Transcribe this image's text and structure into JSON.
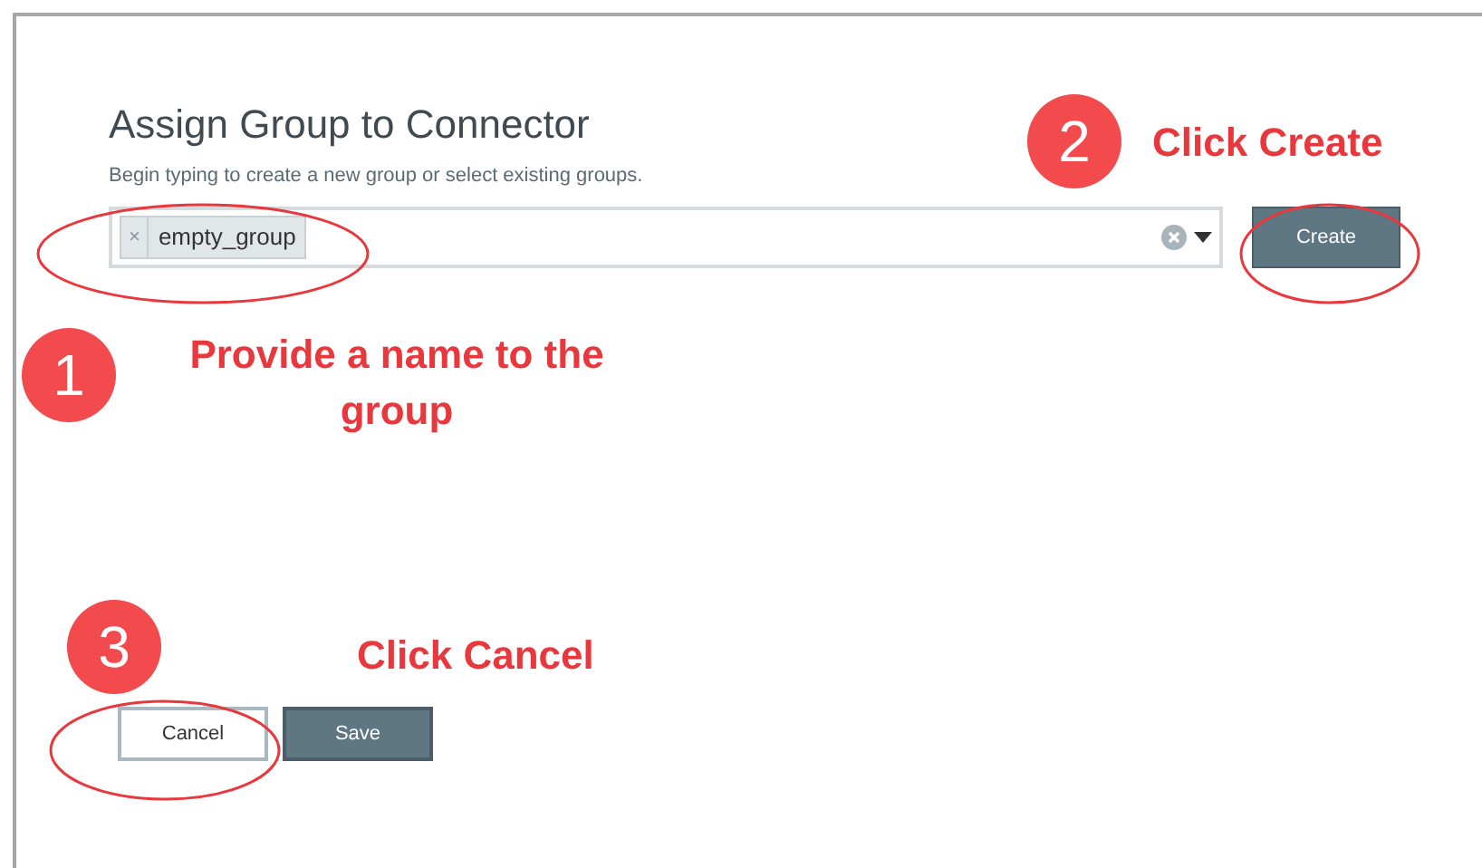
{
  "dialog": {
    "title": "Assign Group to Connector",
    "description": "Begin typing to create a new group or select existing groups.",
    "tags": [
      {
        "label": "empty_group",
        "remove": "×"
      }
    ],
    "create_button": "Create",
    "buttons": [
      {
        "label": "Cancel",
        "kind": "secondary"
      },
      {
        "label": "Save",
        "kind": "primary"
      }
    ]
  },
  "annotations": [
    {
      "number": "1",
      "text": "Provide a name to the group"
    },
    {
      "number": "2",
      "text": "Click Create"
    },
    {
      "number": "3",
      "text": "Click Cancel"
    }
  ]
}
